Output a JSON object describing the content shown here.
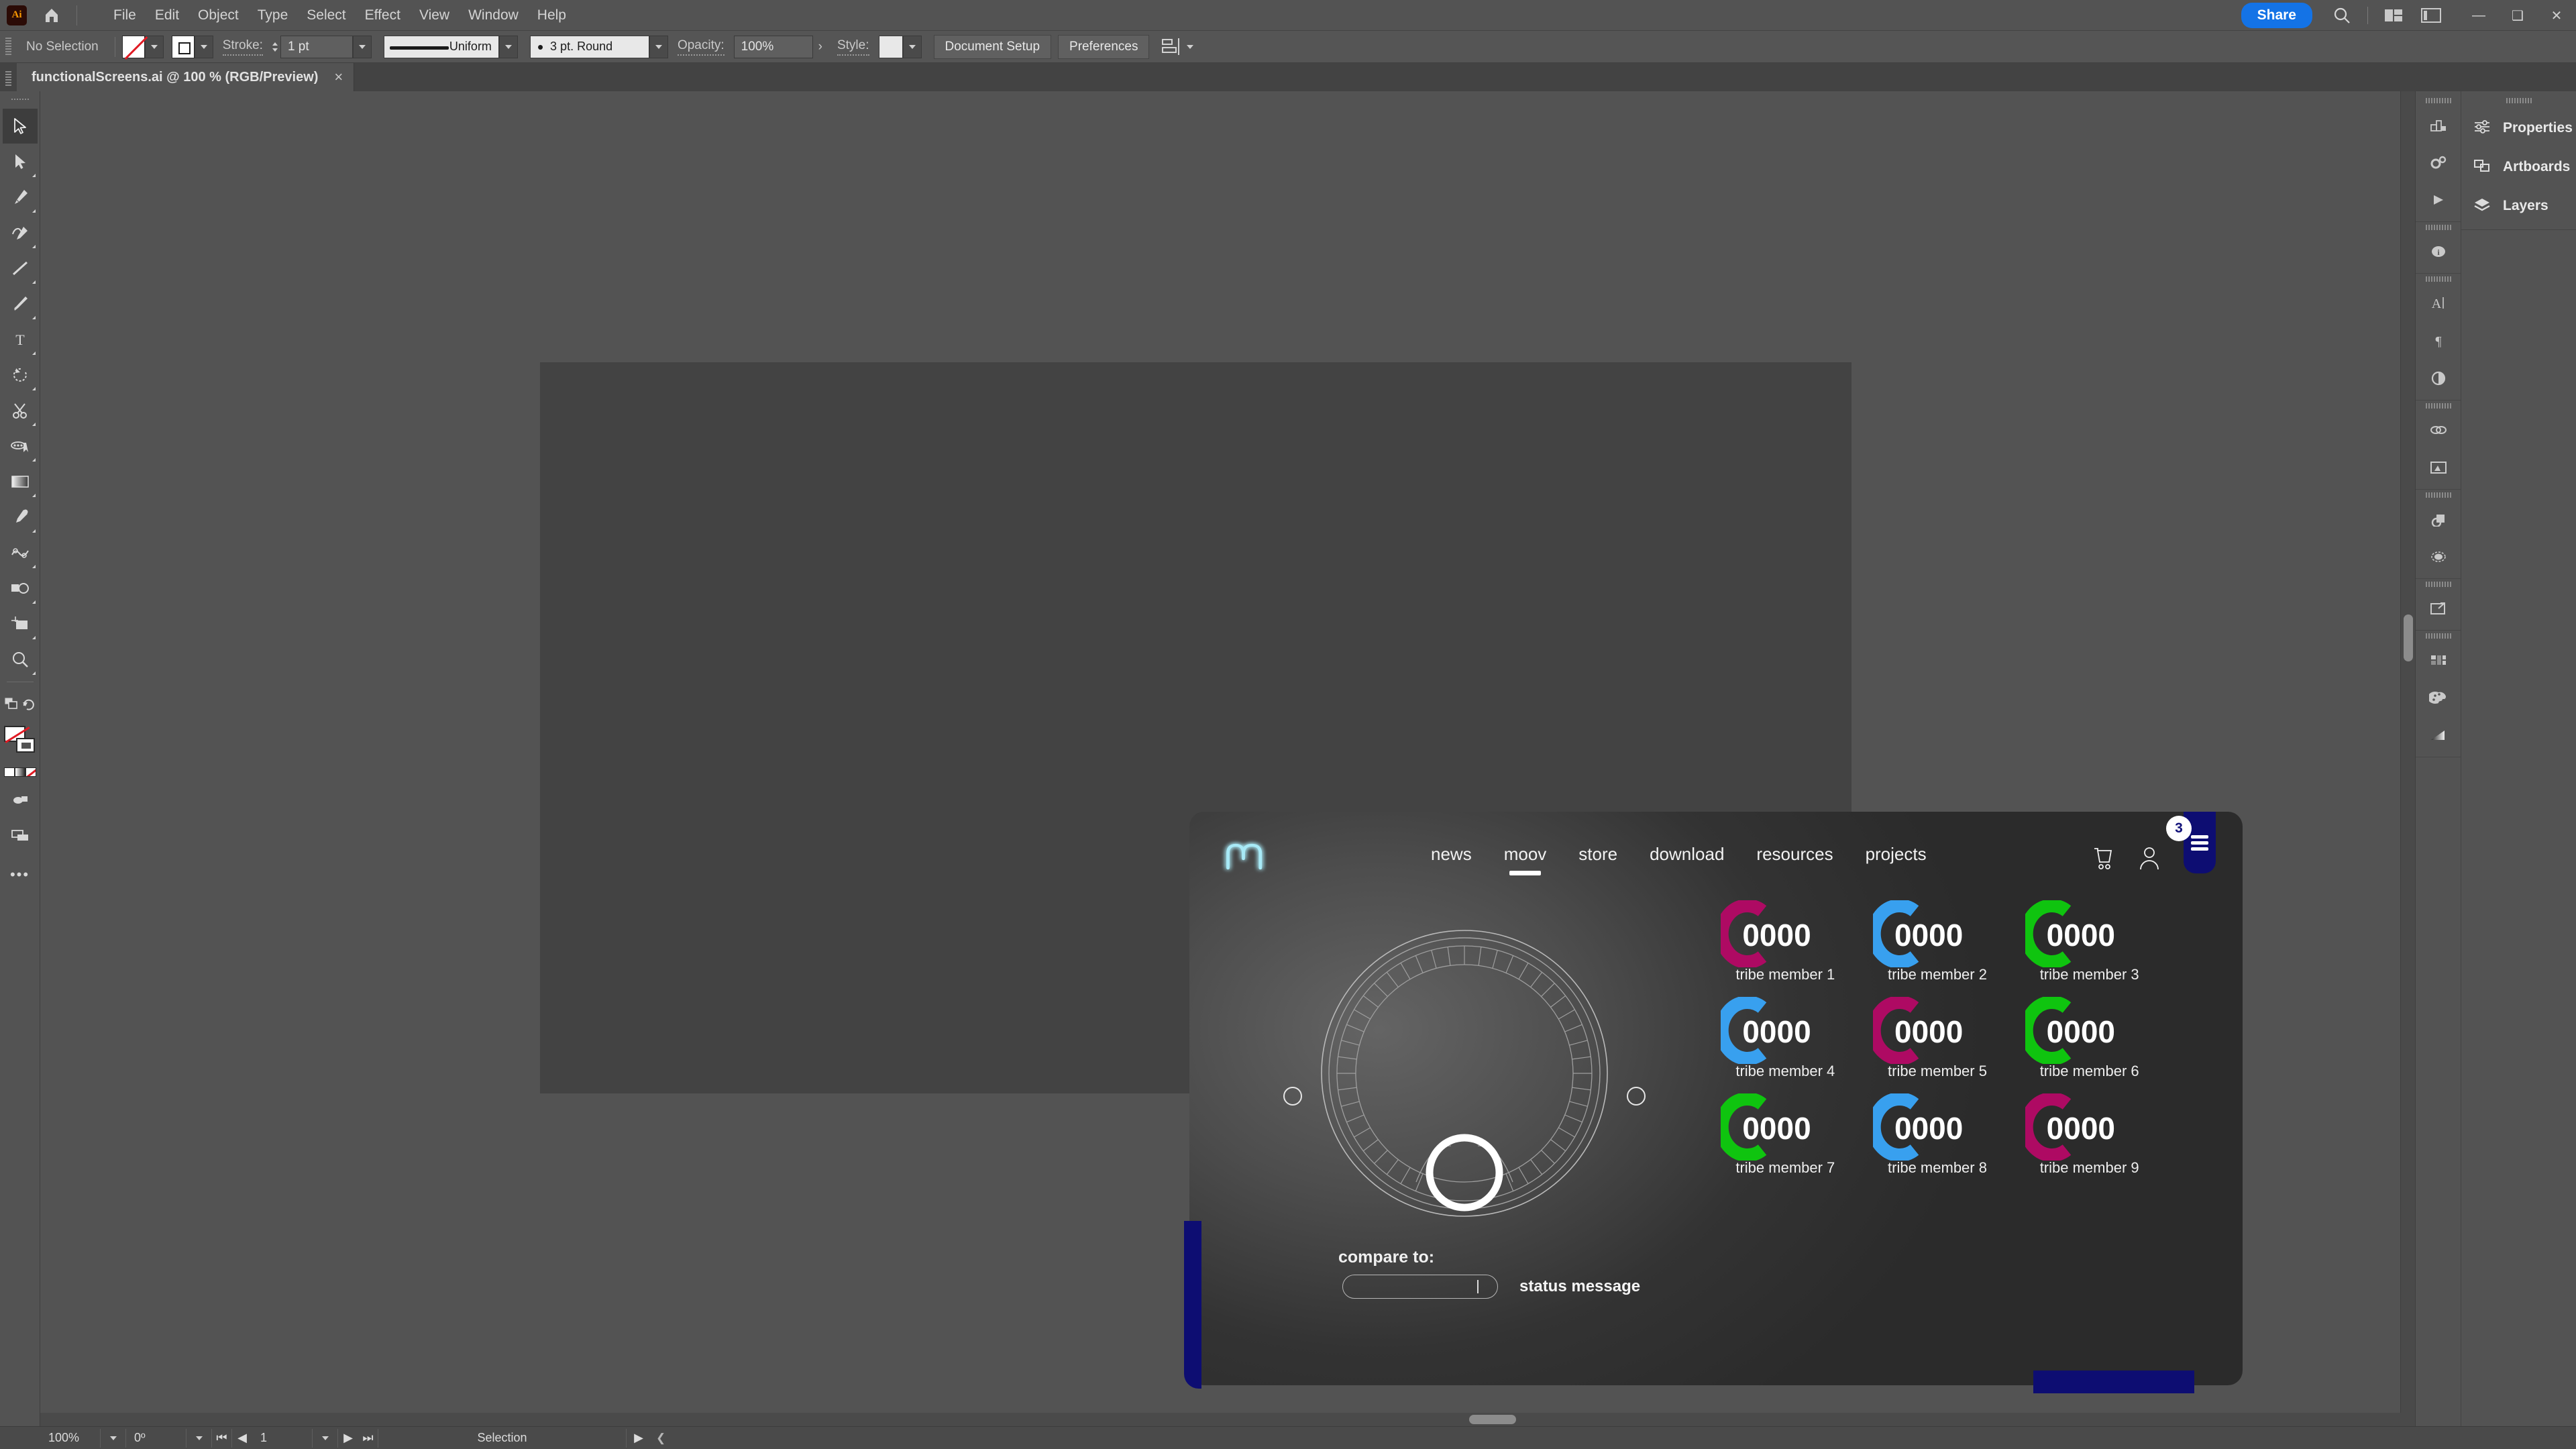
{
  "app": {
    "name": "Ai",
    "menu": [
      "File",
      "Edit",
      "Object",
      "Type",
      "Select",
      "Effect",
      "View",
      "Window",
      "Help"
    ],
    "share_label": "Share"
  },
  "control_bar": {
    "selection_status": "No Selection",
    "fill_label": "fill-swatch",
    "stroke_label": "Stroke:",
    "stroke_weight": "1 pt",
    "stroke_profile": "Uniform",
    "brush_definition": "3 pt. Round",
    "opacity_label": "Opacity:",
    "opacity_value": "100%",
    "style_label": "Style:",
    "document_setup": "Document Setup",
    "preferences": "Preferences"
  },
  "document_tab": {
    "title": "functionalScreens.ai @ 100 % (RGB/Preview)",
    "close": "×"
  },
  "tools": [
    {
      "name": "selection-tool",
      "glyph": "selection"
    },
    {
      "name": "direct-selection-tool",
      "glyph": "direct-selection"
    },
    {
      "name": "pen-tool",
      "glyph": "pen"
    },
    {
      "name": "curvature-tool",
      "glyph": "curvature"
    },
    {
      "name": "line-segment-tool",
      "glyph": "line"
    },
    {
      "name": "paintbrush-tool",
      "glyph": "brush"
    },
    {
      "name": "type-tool",
      "glyph": "T"
    },
    {
      "name": "rotate-tool",
      "glyph": "rotate"
    },
    {
      "name": "scissors-tool",
      "glyph": "scissors"
    },
    {
      "name": "free-transform-tool",
      "glyph": "transform"
    },
    {
      "name": "gradient-tool",
      "glyph": "gradient"
    },
    {
      "name": "eyedropper-tool",
      "glyph": "eyedropper"
    },
    {
      "name": "blend-tool",
      "glyph": "blend"
    },
    {
      "name": "shape-builder-tool",
      "glyph": "shape-builder"
    },
    {
      "name": "artboard-tool",
      "glyph": "artboard"
    },
    {
      "name": "zoom-tool",
      "glyph": "zoom"
    }
  ],
  "right_panel": {
    "tabs": [
      {
        "label": "Properties",
        "icon": "sliders-icon"
      },
      {
        "label": "Artboards",
        "icon": "artboards-icon"
      },
      {
        "label": "Layers",
        "icon": "layers-icon"
      }
    ],
    "dock_icons": [
      "chart-icon",
      "gears-icon",
      "play-icon",
      "info-icon",
      "character-icon",
      "paragraph-icon",
      "opacity-icon",
      "links-icon",
      "image-trace-icon",
      "symbols-icon",
      "transparency-icon",
      "export-icon",
      "swatches-icon",
      "color-palette-icon",
      "gradient-icon"
    ]
  },
  "status_bar": {
    "zoom": "100%",
    "rotation": "0º",
    "artboard_number": "1",
    "tool_status": "Selection"
  },
  "artwork": {
    "brand": {
      "logo": "moov-logo",
      "glow_color": "#9fe8f5"
    },
    "nav": {
      "items": [
        {
          "label": "news",
          "active": false
        },
        {
          "label": "moov",
          "active": true
        },
        {
          "label": "store",
          "active": false
        },
        {
          "label": "download",
          "active": false
        },
        {
          "label": "resources",
          "active": false
        },
        {
          "label": "projects",
          "active": false
        }
      ],
      "cart_icon": "shopping-cart-icon",
      "account_icon": "user-account-icon",
      "menu_icon": "hamburger-menu-icon",
      "menu_badge": "3",
      "menu_color": "#0d0d72"
    },
    "dial": {
      "name": "rotary-dial-control",
      "ticks": 48,
      "left_dot": "dial-left-handle",
      "right_dot": "dial-right-handle"
    },
    "compare": {
      "label": "compare to:",
      "input_value": "",
      "input_placeholder": "",
      "status_message": "status message"
    },
    "tribe_members": [
      {
        "name": "tribe member 1",
        "value": "0000",
        "color": "#ae0a63"
      },
      {
        "name": "tribe member 2",
        "value": "0000",
        "color": "#38a0ef"
      },
      {
        "name": "tribe member 3",
        "value": "0000",
        "color": "#0fc40f"
      },
      {
        "name": "tribe member 4",
        "value": "0000",
        "color": "#38a0ef"
      },
      {
        "name": "tribe member 5",
        "value": "0000",
        "color": "#ae0a63"
      },
      {
        "name": "tribe member 6",
        "value": "0000",
        "color": "#0fc40f"
      },
      {
        "name": "tribe member 7",
        "value": "0000",
        "color": "#0fc40f"
      },
      {
        "name": "tribe member 8",
        "value": "0000",
        "color": "#38a0ef"
      },
      {
        "name": "tribe member 9",
        "value": "0000",
        "color": "#ae0a63"
      }
    ],
    "accent_blocks": {
      "left_strip": "#0d0d72",
      "bottom_bar": "#0d0d72"
    }
  }
}
